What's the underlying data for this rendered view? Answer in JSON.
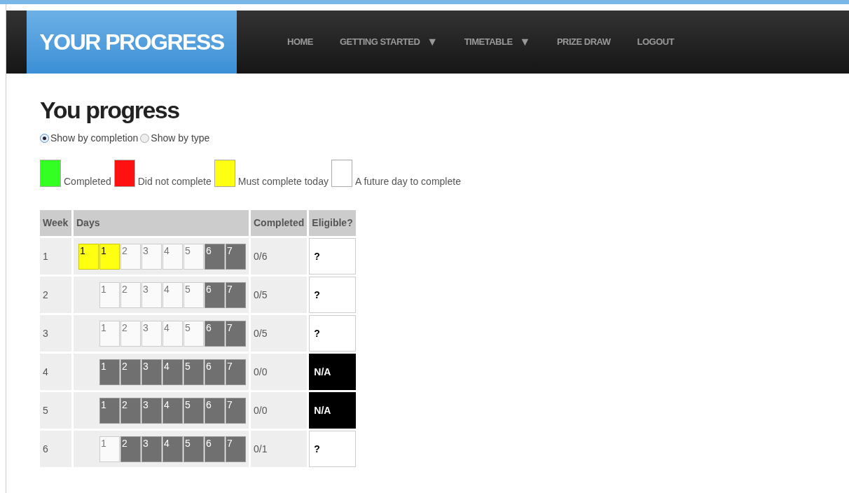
{
  "header": {
    "logo": "YOUR PROGRESS",
    "nav": [
      {
        "label": "HOME"
      },
      {
        "label": "GETTING STARTED",
        "caret": "▼"
      },
      {
        "label": "TIMETABLE",
        "caret": "▼"
      },
      {
        "label": "PRIZE DRAW"
      },
      {
        "label": "LOGOUT"
      }
    ]
  },
  "title": "You progress",
  "view_options": [
    {
      "label": "Show by completion",
      "selected": true
    },
    {
      "label": "Show by type",
      "selected": false
    }
  ],
  "legend": [
    {
      "label": "Completed",
      "color": "#33ff22"
    },
    {
      "label": "Did not complete",
      "color": "#ff1111"
    },
    {
      "label": "Must complete today",
      "color": "#ffff11"
    },
    {
      "label": "A future day to complete",
      "color": "#ffffff"
    }
  ],
  "table": {
    "columns": [
      "Week",
      "Days",
      "Completed",
      "Eligible?"
    ],
    "rows": [
      {
        "week": "1",
        "days": [
          {
            "label": "1",
            "kind": "today"
          },
          {
            "label": "1",
            "kind": "today"
          },
          {
            "label": "2",
            "kind": "future"
          },
          {
            "label": "3",
            "kind": "future"
          },
          {
            "label": "4",
            "kind": "future"
          },
          {
            "label": "5",
            "kind": "future"
          },
          {
            "label": "6",
            "kind": "unavailable"
          },
          {
            "label": "7",
            "kind": "unavailable"
          }
        ],
        "completed": "0/6",
        "eligible": {
          "text": "?",
          "kind": "open"
        }
      },
      {
        "week": "2",
        "days": [
          {
            "label": "1",
            "kind": "future"
          },
          {
            "label": "2",
            "kind": "future"
          },
          {
            "label": "3",
            "kind": "future"
          },
          {
            "label": "4",
            "kind": "future"
          },
          {
            "label": "5",
            "kind": "future"
          },
          {
            "label": "6",
            "kind": "unavailable"
          },
          {
            "label": "7",
            "kind": "unavailable"
          }
        ],
        "completed": "0/5",
        "eligible": {
          "text": "?",
          "kind": "open"
        }
      },
      {
        "week": "3",
        "days": [
          {
            "label": "1",
            "kind": "future"
          },
          {
            "label": "2",
            "kind": "future"
          },
          {
            "label": "3",
            "kind": "future"
          },
          {
            "label": "4",
            "kind": "future"
          },
          {
            "label": "5",
            "kind": "future"
          },
          {
            "label": "6",
            "kind": "unavailable"
          },
          {
            "label": "7",
            "kind": "unavailable"
          }
        ],
        "completed": "0/5",
        "eligible": {
          "text": "?",
          "kind": "open"
        }
      },
      {
        "week": "4",
        "days": [
          {
            "label": "1",
            "kind": "unavailable"
          },
          {
            "label": "2",
            "kind": "unavailable"
          },
          {
            "label": "3",
            "kind": "unavailable"
          },
          {
            "label": "4",
            "kind": "unavailable"
          },
          {
            "label": "5",
            "kind": "unavailable"
          },
          {
            "label": "6",
            "kind": "unavailable"
          },
          {
            "label": "7",
            "kind": "unavailable"
          }
        ],
        "completed": "0/0",
        "eligible": {
          "text": "N/A",
          "kind": "na"
        }
      },
      {
        "week": "5",
        "days": [
          {
            "label": "1",
            "kind": "unavailable"
          },
          {
            "label": "2",
            "kind": "unavailable"
          },
          {
            "label": "3",
            "kind": "unavailable"
          },
          {
            "label": "4",
            "kind": "unavailable"
          },
          {
            "label": "5",
            "kind": "unavailable"
          },
          {
            "label": "6",
            "kind": "unavailable"
          },
          {
            "label": "7",
            "kind": "unavailable"
          }
        ],
        "completed": "0/0",
        "eligible": {
          "text": "N/A",
          "kind": "na"
        }
      },
      {
        "week": "6",
        "days": [
          {
            "label": "1",
            "kind": "future"
          },
          {
            "label": "2",
            "kind": "unavailable"
          },
          {
            "label": "3",
            "kind": "unavailable"
          },
          {
            "label": "4",
            "kind": "unavailable"
          },
          {
            "label": "5",
            "kind": "unavailable"
          },
          {
            "label": "6",
            "kind": "unavailable"
          },
          {
            "label": "7",
            "kind": "unavailable"
          }
        ],
        "completed": "0/1",
        "eligible": {
          "text": "?",
          "kind": "open"
        }
      }
    ]
  }
}
